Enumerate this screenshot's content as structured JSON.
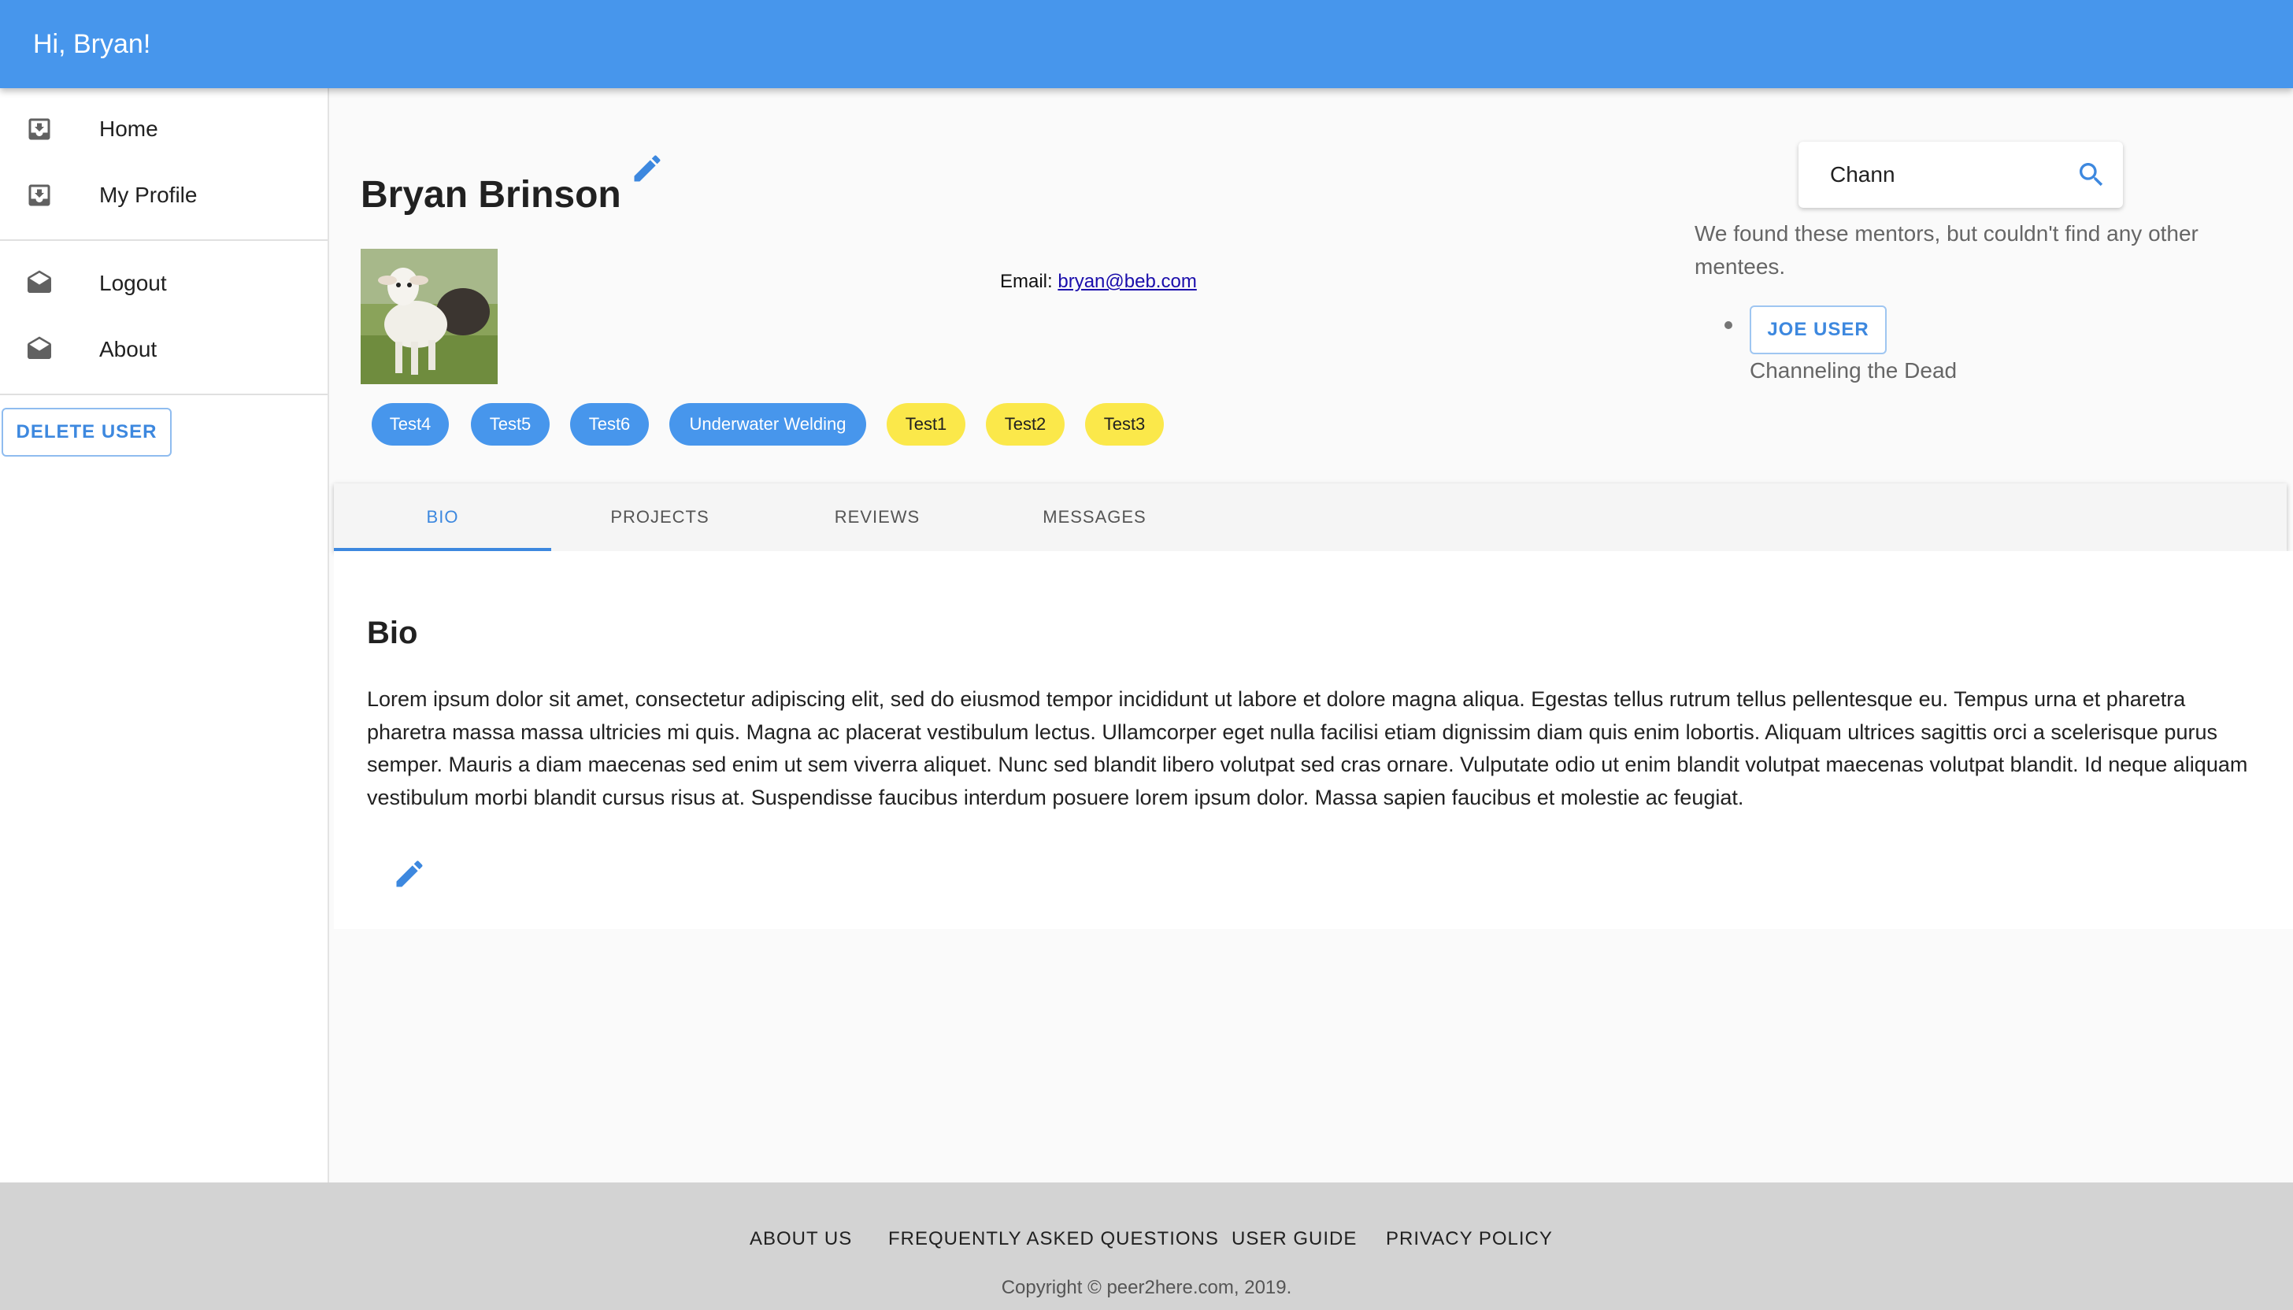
{
  "appbar": {
    "title": "Hi, Bryan!"
  },
  "sidebar": {
    "items": [
      {
        "label": "Home",
        "icon": "inbox-download-icon"
      },
      {
        "label": "My Profile",
        "icon": "inbox-download-icon"
      },
      {
        "label": "Logout",
        "icon": "drafts-icon"
      },
      {
        "label": "About",
        "icon": "drafts-icon"
      }
    ],
    "delete_button": "DELETE USER"
  },
  "profile": {
    "name": "Bryan Brinson",
    "email_label": "Email:",
    "email": "bryan@beb.com",
    "avatar_alt": "goat-photo",
    "chips": [
      {
        "label": "Test4",
        "color": "blue"
      },
      {
        "label": "Test5",
        "color": "blue"
      },
      {
        "label": "Test6",
        "color": "blue"
      },
      {
        "label": "Underwater Welding",
        "color": "blue"
      },
      {
        "label": "Test1",
        "color": "yellow"
      },
      {
        "label": "Test2",
        "color": "yellow"
      },
      {
        "label": "Test3",
        "color": "yellow"
      }
    ]
  },
  "search": {
    "value": "Chann",
    "message": "We found these mentors, but couldn't find any other mentees.",
    "results": [
      {
        "name": "JOE USER",
        "description": "Channeling the Dead"
      }
    ]
  },
  "tabs": [
    {
      "label": "BIO",
      "active": true
    },
    {
      "label": "PROJECTS",
      "active": false
    },
    {
      "label": "REVIEWS",
      "active": false
    },
    {
      "label": "MESSAGES",
      "active": false
    }
  ],
  "bio": {
    "title": "Bio",
    "text": "Lorem ipsum dolor sit amet, consectetur adipiscing elit, sed do eiusmod tempor incididunt ut labore et dolore magna aliqua. Egestas tellus rutrum tellus pellentesque eu. Tempus urna et pharetra pharetra massa massa ultricies mi quis. Magna ac placerat vestibulum lectus. Ullamcorper eget nulla facilisi etiam dignissim diam quis enim lobortis. Aliquam ultrices sagittis orci a scelerisque purus semper. Mauris a diam maecenas sed enim ut sem viverra aliquet. Nunc sed blandit libero volutpat sed cras ornare. Vulputate odio ut enim blandit volutpat maecenas volutpat blandit. Id neque aliquam vestibulum morbi blandit cursus risus at. Suspendisse faucibus interdum posuere lorem ipsum dolor. Massa sapien faucibus et molestie ac feugiat."
  },
  "footer": {
    "links": [
      "ABOUT US",
      "FREQUENTLY ASKED QUESTIONS",
      "USER GUIDE",
      "PRIVACY POLICY"
    ],
    "copyright": "Copyright © peer2here.com, 2019."
  },
  "colors": {
    "primary": "#4796ec",
    "accent": "#3d88df",
    "chip_yellow": "#fbe84a",
    "footer_bg": "#d3d3d3"
  }
}
